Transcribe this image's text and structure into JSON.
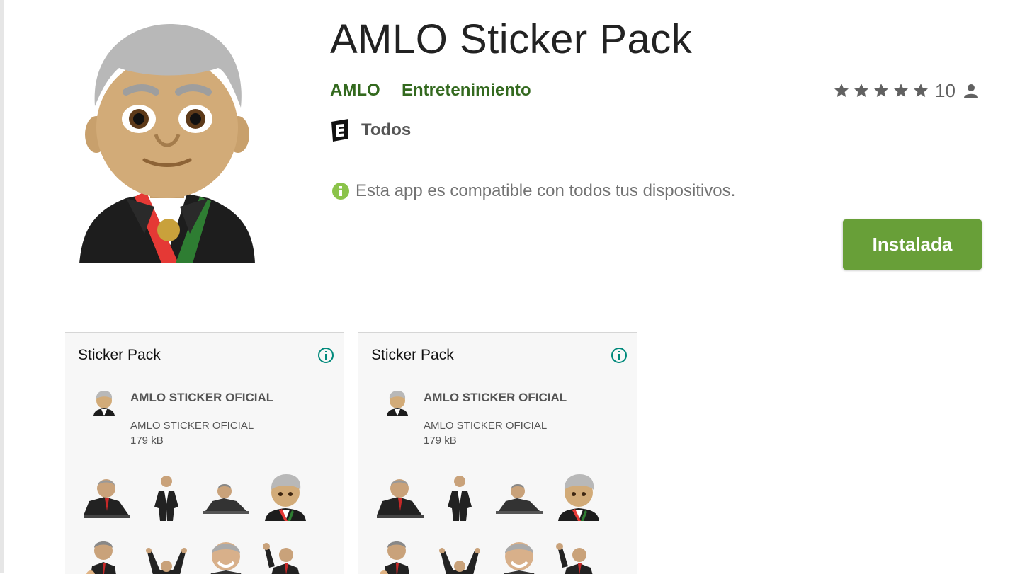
{
  "app": {
    "title": "AMLO Sticker Pack",
    "developer": "AMLO",
    "category": "Entretenimiento",
    "rating": {
      "stars": 5,
      "max": 5,
      "count": "10"
    },
    "content_rating": {
      "icon": "esrb-e-icon",
      "label": "Todos"
    },
    "compatibility": {
      "icon": "info-circle-icon",
      "text": "Esta app es compatible con todos tus dispositivos."
    },
    "install_button": {
      "label": "Instalada"
    },
    "icon": "amlo-avatar-icon"
  },
  "colors": {
    "brand_green": "#33691e",
    "button_green": "#689f38",
    "compat_icon": "#8bc34a",
    "info_teal": "#00897b",
    "star_gray": "#616161"
  },
  "screenshots": [
    {
      "header": "Sticker Pack",
      "pack": {
        "name": "AMLO STICKER OFICIAL",
        "subtitle": "AMLO STICKER OFICIAL",
        "size": "179 kB"
      },
      "stickers": [
        "sticker-desk-speech",
        "sticker-standing-suit",
        "sticker-table-talk",
        "sticker-avatar",
        "sticker-thumbs-up",
        "sticker-arms-raised",
        "sticker-smiling-face",
        "sticker-waving"
      ]
    },
    {
      "header": "Sticker Pack",
      "pack": {
        "name": "AMLO STICKER OFICIAL",
        "subtitle": "AMLO STICKER OFICIAL",
        "size": "179 kB"
      },
      "stickers": [
        "sticker-desk-speech",
        "sticker-standing-suit",
        "sticker-table-talk",
        "sticker-avatar",
        "sticker-thumbs-up",
        "sticker-arms-raised",
        "sticker-smiling-face",
        "sticker-waving"
      ]
    }
  ]
}
